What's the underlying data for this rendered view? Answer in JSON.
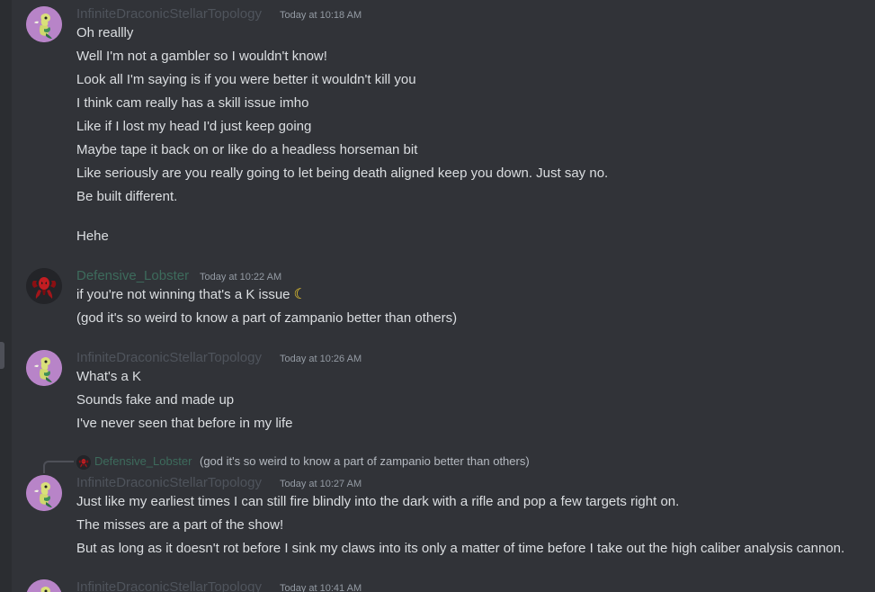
{
  "colors": {
    "background": "#313338",
    "message_text": "#dbdee1",
    "timestamp": "#949ba4",
    "dragon_name": "#4f545c",
    "lobster_name": "#3d6b5c",
    "moon_emoji": "#f7d22e"
  },
  "messages": [
    {
      "author": "InfiniteDraconicStellarTopology",
      "timestamp": "Today at 10:18 AM",
      "avatar_icon": "dragon-avatar-icon",
      "lines": [
        "Oh reallly",
        "Well I'm not a gambler so I wouldn't know!",
        "Look all I'm saying is if you were better it wouldn't kill you",
        "I think cam really has a skill issue imho",
        "Like if I lost my head I'd just keep going",
        "Maybe tape it back on or like do a headless horseman bit",
        "Like seriously are you really going to let being death aligned keep you down. Just say no.",
        "Be built different.",
        "Hehe"
      ]
    },
    {
      "author": "Defensive_Lobster",
      "timestamp": "Today at 10:22 AM",
      "avatar_icon": "lobster-avatar-icon",
      "lines": [
        "if you're not winning that's a K issue",
        "(god it's so weird to know a part of zampanio better than others)"
      ]
    },
    {
      "author": "InfiniteDraconicStellarTopology",
      "timestamp": "Today at 10:26 AM",
      "avatar_icon": "dragon-avatar-icon",
      "lines": [
        "What's a K",
        "Sounds fake and made up",
        "I've never seen that before in my life"
      ]
    },
    {
      "author": "InfiniteDraconicStellarTopology",
      "timestamp": "Today at 10:27 AM",
      "avatar_icon": "dragon-avatar-icon",
      "reply": {
        "author": "Defensive_Lobster",
        "text": "(god it's so weird to know a part of zampanio better than others)"
      },
      "lines": [
        "Just like my earliest times I can still fire blindly into the dark with a rifle and pop a few targets right on.",
        "The misses are a part of the show!",
        "But as long as it doesn't rot before I sink my claws into its only a matter of time before I take out the high caliber analysis cannon."
      ]
    },
    {
      "author": "InfiniteDraconicStellarTopology",
      "timestamp": "Today at 10:41 AM",
      "avatar_icon": "dragon-avatar-icon",
      "lines": []
    }
  ]
}
